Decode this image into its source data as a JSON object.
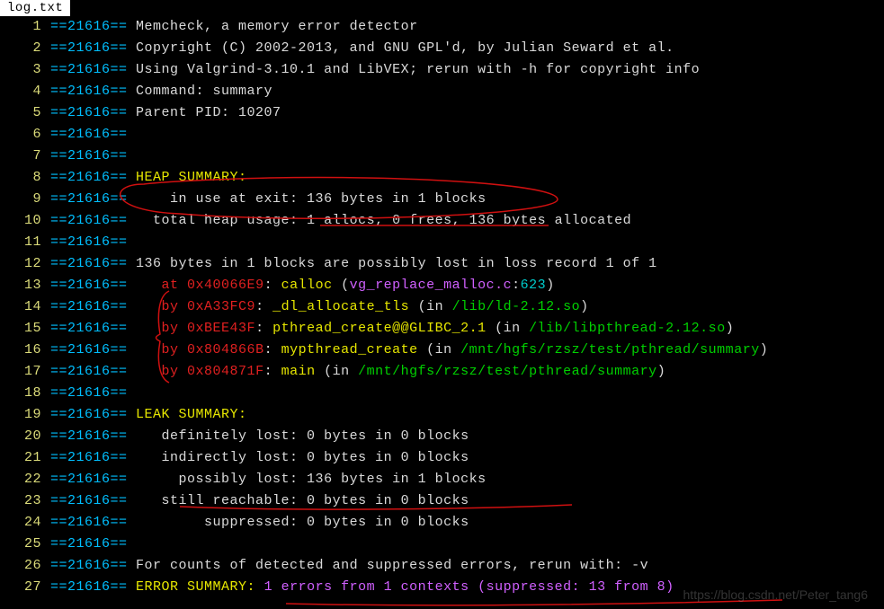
{
  "tab": {
    "title": "log.txt"
  },
  "pid": "21616",
  "lines": [
    {
      "n": 1,
      "segs": [
        {
          "c": "txt",
          "t": "Memcheck, a memory error detector"
        }
      ]
    },
    {
      "n": 2,
      "segs": [
        {
          "c": "txt",
          "t": "Copyright (C) 2002-2013, and GNU GPL'd, by Julian Seward et al."
        }
      ]
    },
    {
      "n": 3,
      "segs": [
        {
          "c": "txt",
          "t": "Using Valgrind-3.10.1 and LibVEX; rerun with -h for copyright info"
        }
      ]
    },
    {
      "n": 4,
      "segs": [
        {
          "c": "txt",
          "t": "Command: summary"
        }
      ]
    },
    {
      "n": 5,
      "segs": [
        {
          "c": "txt",
          "t": "Parent PID: 10207"
        }
      ]
    },
    {
      "n": 6,
      "segs": []
    },
    {
      "n": 7,
      "segs": []
    },
    {
      "n": 8,
      "segs": [
        {
          "c": "yellow",
          "t": "HEAP SUMMARY:"
        }
      ]
    },
    {
      "n": 9,
      "segs": [
        {
          "c": "txt",
          "t": "    in use at exit: 136 bytes in 1 blocks"
        }
      ]
    },
    {
      "n": 10,
      "segs": [
        {
          "c": "txt",
          "t": "  total heap usage: 1 allocs, 0 frees, 136 bytes allocated"
        }
      ]
    },
    {
      "n": 11,
      "segs": []
    },
    {
      "n": 12,
      "segs": [
        {
          "c": "txt",
          "t": "136 bytes in 1 blocks are possibly lost in loss record 1 of 1"
        }
      ]
    },
    {
      "n": 13,
      "segs": [
        {
          "c": "txt",
          "t": "   "
        },
        {
          "c": "red",
          "t": "at 0x40066E9"
        },
        {
          "c": "txt",
          "t": ": "
        },
        {
          "c": "yellow",
          "t": "calloc"
        },
        {
          "c": "txt",
          "t": " ("
        },
        {
          "c": "magenta",
          "t": "vg_replace_malloc.c"
        },
        {
          "c": "txt",
          "t": ":"
        },
        {
          "c": "cyan",
          "t": "623"
        },
        {
          "c": "txt",
          "t": ")"
        }
      ]
    },
    {
      "n": 14,
      "segs": [
        {
          "c": "txt",
          "t": "   "
        },
        {
          "c": "red",
          "t": "by 0xA33FC9"
        },
        {
          "c": "txt",
          "t": ": "
        },
        {
          "c": "yellow",
          "t": "_dl_allocate_tls"
        },
        {
          "c": "txt",
          "t": " (in "
        },
        {
          "c": "green",
          "t": "/lib/ld-2.12.so"
        },
        {
          "c": "txt",
          "t": ")"
        }
      ]
    },
    {
      "n": 15,
      "segs": [
        {
          "c": "txt",
          "t": "   "
        },
        {
          "c": "red",
          "t": "by 0xBEE43F"
        },
        {
          "c": "txt",
          "t": ": "
        },
        {
          "c": "yellow",
          "t": "pthread_create@@GLIBC_2.1"
        },
        {
          "c": "txt",
          "t": " (in "
        },
        {
          "c": "green",
          "t": "/lib/libpthread-2.12.so"
        },
        {
          "c": "txt",
          "t": ")"
        }
      ]
    },
    {
      "n": 16,
      "segs": [
        {
          "c": "txt",
          "t": "   "
        },
        {
          "c": "red",
          "t": "by 0x804866B"
        },
        {
          "c": "txt",
          "t": ": "
        },
        {
          "c": "yellow",
          "t": "mypthread_create"
        },
        {
          "c": "txt",
          "t": " (in "
        },
        {
          "c": "green",
          "t": "/mnt/hgfs/rzsz/test/pthread/summary"
        },
        {
          "c": "txt",
          "t": ")"
        }
      ]
    },
    {
      "n": 17,
      "segs": [
        {
          "c": "txt",
          "t": "   "
        },
        {
          "c": "red",
          "t": "by 0x804871F"
        },
        {
          "c": "txt",
          "t": ": "
        },
        {
          "c": "yellow",
          "t": "main"
        },
        {
          "c": "txt",
          "t": " (in "
        },
        {
          "c": "green",
          "t": "/mnt/hgfs/rzsz/test/pthread/summary"
        },
        {
          "c": "txt",
          "t": ")"
        }
      ]
    },
    {
      "n": 18,
      "segs": []
    },
    {
      "n": 19,
      "segs": [
        {
          "c": "yellow",
          "t": "LEAK SUMMARY:"
        }
      ]
    },
    {
      "n": 20,
      "segs": [
        {
          "c": "txt",
          "t": "   definitely lost: 0 bytes in 0 blocks"
        }
      ]
    },
    {
      "n": 21,
      "segs": [
        {
          "c": "txt",
          "t": "   indirectly lost: 0 bytes in 0 blocks"
        }
      ]
    },
    {
      "n": 22,
      "segs": [
        {
          "c": "txt",
          "t": "     possibly lost: 136 bytes in 1 blocks"
        }
      ]
    },
    {
      "n": 23,
      "segs": [
        {
          "c": "txt",
          "t": "   still reachable: 0 bytes in 0 blocks"
        }
      ]
    },
    {
      "n": 24,
      "segs": [
        {
          "c": "txt",
          "t": "        suppressed: 0 bytes in 0 blocks"
        }
      ]
    },
    {
      "n": 25,
      "segs": []
    },
    {
      "n": 26,
      "segs": [
        {
          "c": "txt",
          "t": "For counts of detected and suppressed errors, rerun with: -v"
        }
      ]
    },
    {
      "n": 27,
      "segs": [
        {
          "c": "yellow",
          "t": "ERROR SUMMARY: "
        },
        {
          "c": "magenta",
          "t": "1 errors from 1 contexts (suppressed: 13 from 8)"
        }
      ]
    }
  ],
  "watermark": "https://blog.csdn.net/Peter_tang6"
}
